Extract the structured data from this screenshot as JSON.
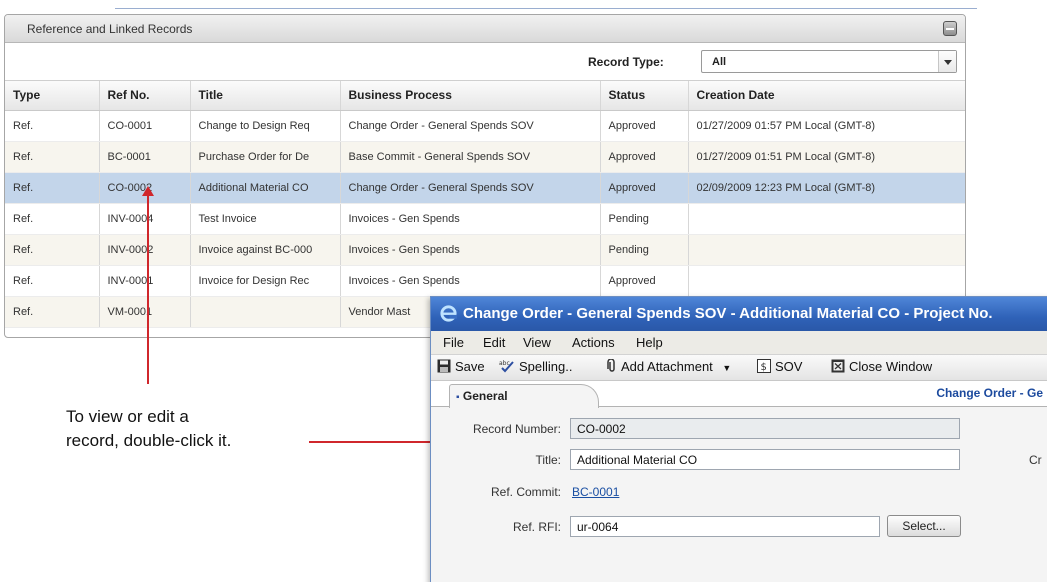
{
  "panel": {
    "title": "Reference and Linked Records",
    "filter_label": "Record Type:",
    "filter_value": "All"
  },
  "table": {
    "headers": [
      "Type",
      "Ref No.",
      "Title",
      "Business Process",
      "Status",
      "Creation Date"
    ],
    "rows": [
      {
        "type": "Ref.",
        "ref": "CO-0001",
        "title": "Change to Design Req",
        "process": "Change Order - General Spends SOV",
        "status": "Approved",
        "date": "01/27/2009 01:57 PM Local (GMT-8)"
      },
      {
        "type": "Ref.",
        "ref": "BC-0001",
        "title": "Purchase Order for De",
        "process": "Base Commit - General Spends SOV",
        "status": "Approved",
        "date": "01/27/2009 01:51 PM Local (GMT-8)"
      },
      {
        "type": "Ref.",
        "ref": "CO-0002",
        "title": "Additional Material CO",
        "process": "Change Order - General Spends SOV",
        "status": "Approved",
        "date": "02/09/2009 12:23 PM Local (GMT-8)"
      },
      {
        "type": "Ref.",
        "ref": "INV-0004",
        "title": "Test Invoice",
        "process": "Invoices - Gen Spends",
        "status": "Pending",
        "date": ""
      },
      {
        "type": "Ref.",
        "ref": "INV-0002",
        "title": "Invoice against BC-000",
        "process": "Invoices - Gen Spends",
        "status": "Pending",
        "date": ""
      },
      {
        "type": "Ref.",
        "ref": "INV-0001",
        "title": "Invoice for Design Rec",
        "process": "Invoices - Gen Spends",
        "status": "Approved",
        "date": ""
      },
      {
        "type": "Ref.",
        "ref": "VM-0001",
        "title": "",
        "process": "Vendor Mast",
        "status": "",
        "date": ""
      }
    ],
    "selected_index": 2
  },
  "annotation": {
    "line1": "To view or edit a",
    "line2": "record, double-click it."
  },
  "window": {
    "title": "Change Order - General Spends SOV - Additional Material CO - Project No.",
    "menu": [
      "File",
      "Edit",
      "View",
      "Actions",
      "Help"
    ],
    "toolbar": {
      "save": "Save",
      "spelling": "Spelling..",
      "add_attachment": "Add Attachment",
      "sov": "SOV",
      "close": "Close Window"
    },
    "tab_general": "General",
    "tab_right_text": "Change Order - Ge",
    "form": {
      "record_number_label": "Record Number:",
      "record_number_value": "CO-0002",
      "title_label": "Title:",
      "title_value": "Additional Material CO",
      "title_right_label": "Cr",
      "ref_commit_label": "Ref. Commit:",
      "ref_commit_value": "BC-0001",
      "ref_rfi_label": "Ref. RFI:",
      "ref_rfi_value": "ur-0064",
      "select_button": "Select..."
    }
  },
  "colors": {
    "selected_row": "#c3d5ea",
    "annotation_arrow": "#d0272c",
    "window_title_bar": "#2f62b8"
  }
}
